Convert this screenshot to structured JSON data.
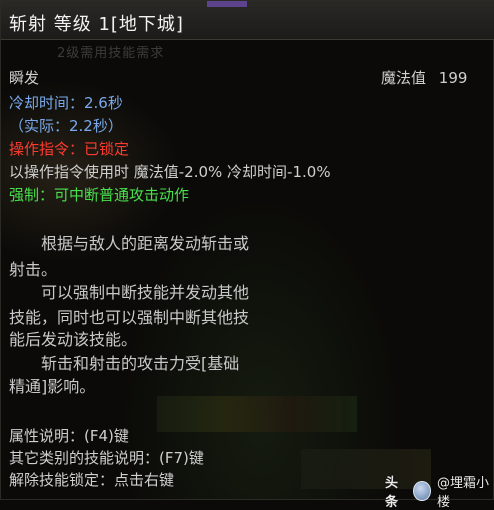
{
  "tooltip": {
    "title": "斩射 等级 1[地下城]",
    "ghost_subtitle": "2级需用技能需求",
    "cast_type": "瞬发",
    "mana_label": "魔法值",
    "mana_value": "199",
    "cooldown": "冷却时间：2.6秒",
    "cooldown_actual": "（实际：2.2秒）",
    "command_status": "操作指令：已锁定",
    "command_bonus": "以操作指令使用时 魔法值-2.0% 冷却时间-1.0%",
    "force": "强制：可中断普通攻击动作",
    "description": [
      "　　根据与敌人的距离发动斩击或",
      "射击。",
      "　　可以强制中断技能并发动其他",
      "技能，同时也可以强制中断其他技",
      "能后发动该技能。",
      "　　斩击和射击的攻击力受[基础",
      "精通]影响。"
    ],
    "footer": [
      "属性说明：(F4)键",
      "其它类别的技能说明：(F7)键",
      "解除技能锁定：点击右键"
    ]
  },
  "watermark": {
    "brand": "头条",
    "author": "@埋霜小楼"
  },
  "colors": {
    "background": "#0b0a08",
    "text_gray": "#cfcfcf",
    "text_blue": "#79a9ec",
    "text_red": "#ff3a2e",
    "text_green": "#49e04e"
  },
  "icons": {
    "watermark_avatar": "avatar-icon"
  }
}
